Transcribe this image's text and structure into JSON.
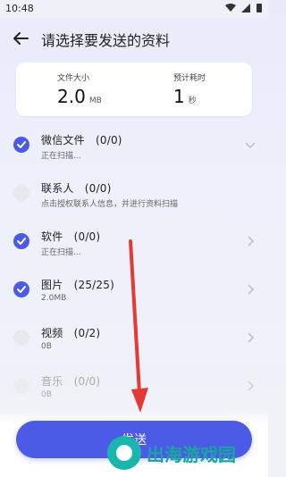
{
  "status_bar": {
    "time": "10:48"
  },
  "header": {
    "title": "请选择要发送的资料"
  },
  "summary": {
    "size_label": "文件大小",
    "size_value": "2.0",
    "size_unit": "MB",
    "time_label": "预计耗时",
    "time_value": "1",
    "time_unit": "秒"
  },
  "items": [
    {
      "title": "微信文件　(0/0)",
      "subtitle": "正在扫描...",
      "checked": true,
      "chevron": "down"
    },
    {
      "title": "联系人　(0/0)",
      "subtitle": "点击授权联系人信息，并进行资料扫描",
      "checked": false,
      "chevron": "none"
    },
    {
      "title": "软件　(0/0)",
      "subtitle": "正在扫描...",
      "checked": true,
      "chevron": "right"
    },
    {
      "title": "图片　(25/25)",
      "subtitle": "2.0MB",
      "checked": true,
      "chevron": "right"
    },
    {
      "title": "视频　(0/2)",
      "subtitle": "0B",
      "checked": false,
      "chevron": "right"
    },
    {
      "title": "音乐　(0/0)",
      "subtitle": "0B",
      "checked": false,
      "chevron": "right"
    }
  ],
  "action_button": {
    "label": "发送"
  },
  "watermark": {
    "text": "出海游戏园"
  },
  "colors": {
    "accent": "#4b5be6",
    "arrow": "#e53935",
    "watermark": "#19a6a1"
  }
}
